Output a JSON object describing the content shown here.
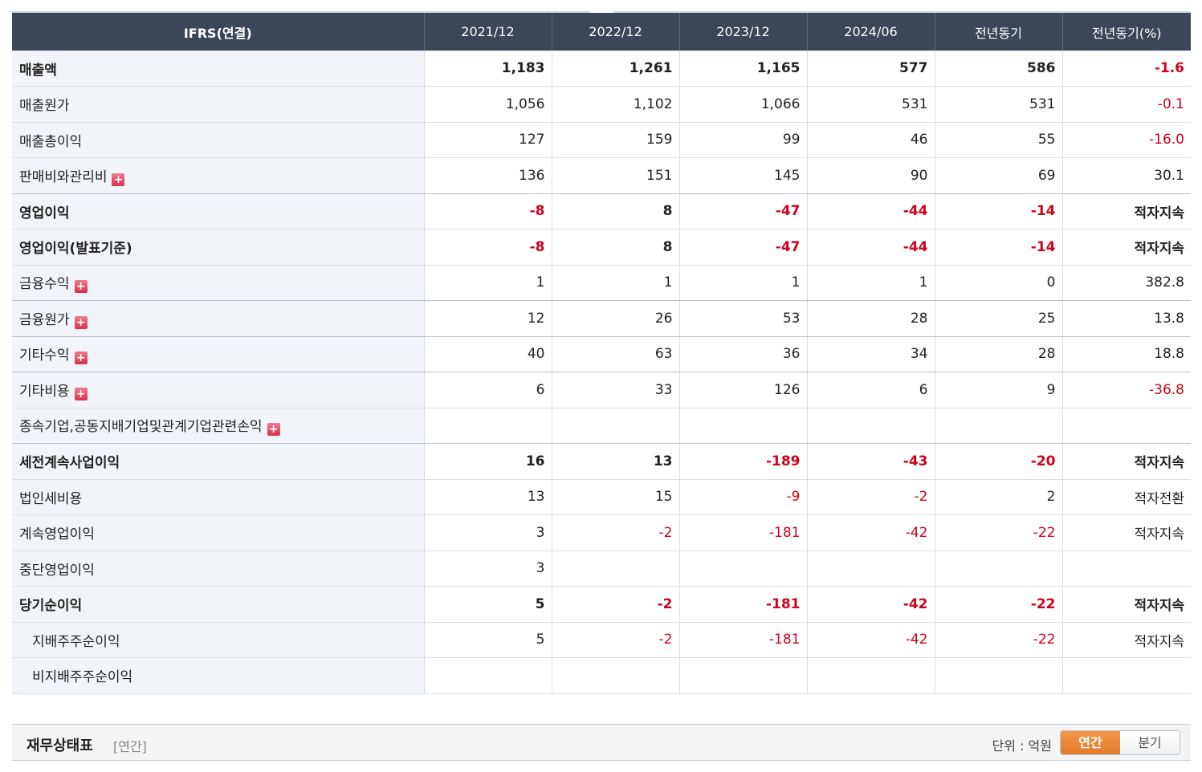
{
  "table": {
    "headers": [
      "IFRS(연결)",
      "2021/12",
      "2022/12",
      "2023/12",
      "2024/06",
      "전년동기",
      "전년동기(%)"
    ],
    "rows": [
      {
        "label": "매출액",
        "bold": true,
        "expand": false,
        "indent": false,
        "values": [
          "1,183",
          "1,261",
          "1,165",
          "577",
          "586",
          "-1.6"
        ],
        "neg": [
          false,
          false,
          false,
          false,
          false,
          true
        ]
      },
      {
        "label": "매출원가",
        "bold": false,
        "expand": false,
        "indent": false,
        "values": [
          "1,056",
          "1,102",
          "1,066",
          "531",
          "531",
          "-0.1"
        ],
        "neg": [
          false,
          false,
          false,
          false,
          false,
          true
        ]
      },
      {
        "label": "매출총이익",
        "bold": false,
        "expand": false,
        "indent": false,
        "values": [
          "127",
          "159",
          "99",
          "46",
          "55",
          "-16.0"
        ],
        "neg": [
          false,
          false,
          false,
          false,
          false,
          true
        ]
      },
      {
        "label": "판매비와관리비",
        "bold": false,
        "expand": true,
        "indent": false,
        "sep": true,
        "values": [
          "136",
          "151",
          "145",
          "90",
          "69",
          "30.1"
        ],
        "neg": [
          false,
          false,
          false,
          false,
          false,
          false
        ]
      },
      {
        "label": "영업이익",
        "bold": true,
        "expand": false,
        "indent": false,
        "values": [
          "-8",
          "8",
          "-47",
          "-44",
          "-14",
          "적자지속"
        ],
        "neg": [
          true,
          false,
          true,
          true,
          true,
          false
        ]
      },
      {
        "label": "영업이익(발표기준)",
        "bold": true,
        "expand": false,
        "indent": false,
        "values": [
          "-8",
          "8",
          "-47",
          "-44",
          "-14",
          "적자지속"
        ],
        "neg": [
          true,
          false,
          true,
          true,
          true,
          false
        ]
      },
      {
        "label": "금융수익",
        "bold": false,
        "expand": true,
        "indent": false,
        "sep": true,
        "values": [
          "1",
          "1",
          "1",
          "1",
          "0",
          "382.8"
        ],
        "neg": [
          false,
          false,
          false,
          false,
          false,
          false
        ]
      },
      {
        "label": "금융원가",
        "bold": false,
        "expand": true,
        "indent": false,
        "sep": true,
        "values": [
          "12",
          "26",
          "53",
          "28",
          "25",
          "13.8"
        ],
        "neg": [
          false,
          false,
          false,
          false,
          false,
          false
        ]
      },
      {
        "label": "기타수익",
        "bold": false,
        "expand": true,
        "indent": false,
        "sep": true,
        "values": [
          "40",
          "63",
          "36",
          "34",
          "28",
          "18.8"
        ],
        "neg": [
          false,
          false,
          false,
          false,
          false,
          false
        ]
      },
      {
        "label": "기타비용",
        "bold": false,
        "expand": true,
        "indent": false,
        "values": [
          "6",
          "33",
          "126",
          "6",
          "9",
          "-36.8"
        ],
        "neg": [
          false,
          false,
          false,
          false,
          false,
          true
        ]
      },
      {
        "label": "종속기업,공동지배기업및관계기업관련손익",
        "bold": false,
        "expand": true,
        "indent": false,
        "sep": true,
        "values": [
          "",
          "",
          "",
          "",
          "",
          ""
        ],
        "neg": [
          false,
          false,
          false,
          false,
          false,
          false
        ]
      },
      {
        "label": "세전계속사업이익",
        "bold": true,
        "expand": false,
        "indent": false,
        "values": [
          "16",
          "13",
          "-189",
          "-43",
          "-20",
          "적자지속"
        ],
        "neg": [
          false,
          false,
          true,
          true,
          true,
          false
        ]
      },
      {
        "label": "법인세비용",
        "bold": false,
        "expand": false,
        "indent": false,
        "values": [
          "13",
          "15",
          "-9",
          "-2",
          "2",
          "적자전환"
        ],
        "neg": [
          false,
          false,
          true,
          true,
          false,
          false
        ]
      },
      {
        "label": "계속영업이익",
        "bold": false,
        "expand": false,
        "indent": false,
        "values": [
          "3",
          "-2",
          "-181",
          "-42",
          "-22",
          "적자지속"
        ],
        "neg": [
          false,
          true,
          true,
          true,
          true,
          false
        ]
      },
      {
        "label": "중단영업이익",
        "bold": false,
        "expand": false,
        "indent": false,
        "values": [
          "3",
          "",
          "",
          "",
          "",
          ""
        ],
        "neg": [
          false,
          false,
          false,
          false,
          false,
          false
        ]
      },
      {
        "label": "당기순이익",
        "bold": true,
        "expand": false,
        "indent": false,
        "values": [
          "5",
          "-2",
          "-181",
          "-42",
          "-22",
          "적자지속"
        ],
        "neg": [
          false,
          true,
          true,
          true,
          true,
          false
        ]
      },
      {
        "label": "지배주주순이익",
        "bold": false,
        "expand": false,
        "indent": true,
        "values": [
          "5",
          "-2",
          "-181",
          "-42",
          "-22",
          "적자지속"
        ],
        "neg": [
          false,
          true,
          true,
          true,
          true,
          false
        ]
      },
      {
        "label": "비지배주주순이익",
        "bold": false,
        "expand": false,
        "indent": true,
        "values": [
          "",
          "",
          "",
          "",
          "",
          ""
        ],
        "neg": [
          false,
          false,
          false,
          false,
          false,
          false
        ]
      }
    ]
  },
  "section": {
    "title": "재무상태표",
    "subtitle": "[연간]",
    "unit": "단위 : 억원",
    "toggle_annual": "연간",
    "toggle_quarter": "분기"
  }
}
